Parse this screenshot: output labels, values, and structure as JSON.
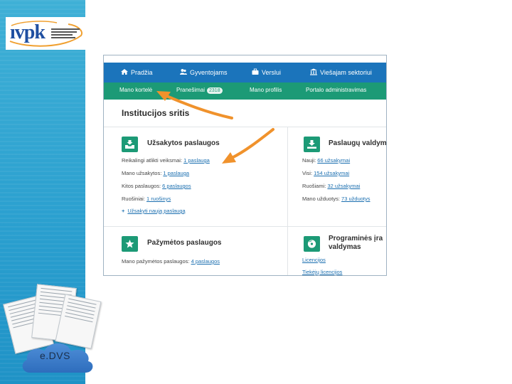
{
  "logo": {
    "brand": "ıvpk"
  },
  "cloud": {
    "label": "e.DVS"
  },
  "topnav": [
    {
      "label": "Pradžia",
      "icon": "home-icon"
    },
    {
      "label": "Gyventojams",
      "icon": "people-icon"
    },
    {
      "label": "Verslui",
      "icon": "briefcase-icon"
    },
    {
      "label": "Viešajam sektoriui",
      "icon": "institution-icon"
    }
  ],
  "subnav": {
    "items": [
      "Mano kortelė",
      "Pranešimai",
      "Mano profilis",
      "Portalo administravimas"
    ],
    "badge": "2318"
  },
  "section_title": "Institucijos sritis",
  "cards": {
    "ordered": {
      "title": "Užsakytos paslaugos",
      "rows": [
        {
          "label": "Reikalingi atlikti veiksmai:",
          "value": "1 paslauga"
        },
        {
          "label": "Mano užsakytos:",
          "value": "1 paslauga"
        },
        {
          "label": "Kitos paslaugos:",
          "value": "6 paslaugos"
        },
        {
          "label": "Ruošiniai:",
          "value": "1 ruošinys"
        }
      ],
      "add_link": "Užsakyti naują paslaugą"
    },
    "management": {
      "title": "Paslaugų valdyma",
      "rows": [
        {
          "label": "Nauji:",
          "value": "66 užsakymai"
        },
        {
          "label": "Visi:",
          "value": "154 užsakymai"
        },
        {
          "label": "Ruošiami:",
          "value": "32 užsakymai"
        },
        {
          "label": "Mano užduotys:",
          "value": "73 užduotys"
        }
      ]
    },
    "marked": {
      "title": "Pažymėtos paslaugos",
      "rows": [
        {
          "label": "Mano pažymėtos paslaugos:",
          "value": "4 paslaugos"
        }
      ]
    },
    "software": {
      "title_line1": "Programinės įra",
      "title_line2": "valdymas",
      "links": [
        "Licencijos",
        "Tiekėjų licencijos"
      ]
    }
  },
  "colors": {
    "nav_blue": "#1b74bb",
    "nav_green": "#1c9a76",
    "arrow_orange": "#f0922c",
    "side_blue": "#2a9fcf"
  }
}
